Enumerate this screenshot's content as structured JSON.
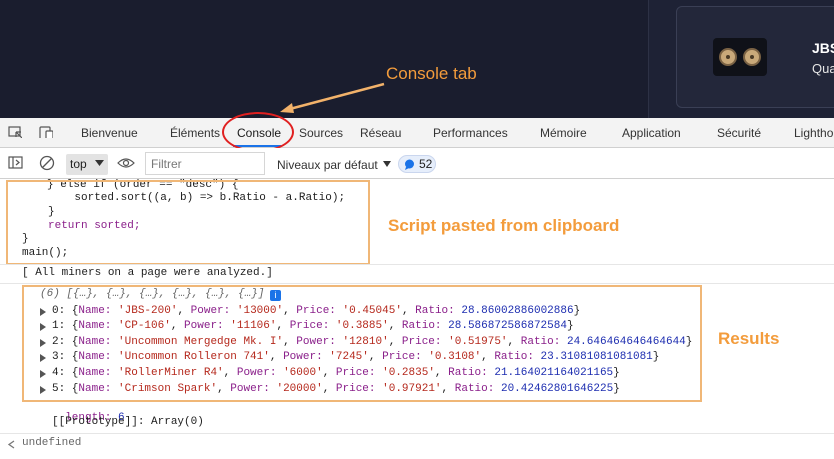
{
  "product_card": {
    "name": "JBS",
    "subtitle": "Qua"
  },
  "annotations": {
    "console_tab": "Console tab",
    "script": "Script pasted from clipboard",
    "results": "Results"
  },
  "devtools_tabs": [
    "Bienvenue",
    "Éléments",
    "Console",
    "Sources",
    "Réseau",
    "Performances",
    "Mémoire",
    "Application",
    "Sécurité",
    "Lighthouse"
  ],
  "toolbar": {
    "context": "top",
    "filter_placeholder": "Filtrer",
    "levels": "Niveaux par défaut",
    "issues_count": "52"
  },
  "script_lines": {
    "l1": "} else if (order == \"desc\") {",
    "l2": "    sorted.sort((a, b) => b.Ratio - a.Ratio);",
    "l3": "}",
    "l4": "return sorted;",
    "l5": "}",
    "l6": "main();"
  },
  "log_message": "[ All miners on a page were analyzed.]",
  "result": {
    "summary": "(6) [{…}, {…}, {…}, {…}, {…}, {…}]",
    "items": [
      {
        "index": "0",
        "name": "'JBS-200'",
        "power": "'13000'",
        "price": "'0.45045'",
        "ratio": "28.86002886002886"
      },
      {
        "index": "1",
        "name": "'CP-106'",
        "power": "'11106'",
        "price": "'0.3885'",
        "ratio": "28.586872586872584"
      },
      {
        "index": "2",
        "name": "'Uncommon Mergedge Mk. I'",
        "power": "'12810'",
        "price": "'0.51975'",
        "ratio": "24.646464646464644"
      },
      {
        "index": "3",
        "name": "'Uncommon Rolleron 741'",
        "power": "'7245'",
        "price": "'0.3108'",
        "ratio": "23.31081081081081"
      },
      {
        "index": "4",
        "name": "'RollerMiner R4'",
        "power": "'6000'",
        "price": "'0.2835'",
        "ratio": "21.164021164021165"
      },
      {
        "index": "5",
        "name": "'Crimson Spark'",
        "power": "'20000'",
        "price": "'0.97921'",
        "ratio": "20.42462801646225"
      }
    ],
    "length_label": "length:",
    "length_value": "6",
    "prototype": "[[Prototype]]: Array(0)"
  },
  "return_value": "undefined",
  "colors": {
    "annotation": "#f39c3c",
    "highlight_circle": "#e02020",
    "active_tab": "#1a73e8"
  }
}
